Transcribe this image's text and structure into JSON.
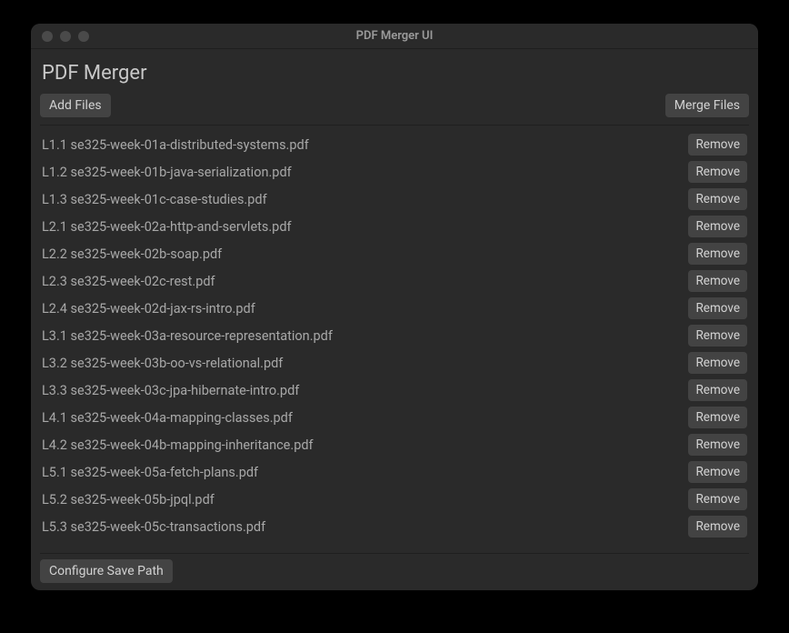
{
  "window": {
    "title": "PDF Merger UI"
  },
  "heading": "PDF Merger",
  "toolbar": {
    "add_files_label": "Add Files",
    "merge_files_label": "Merge Files"
  },
  "files": [
    {
      "name": "L1.1 se325-week-01a-distributed-systems.pdf"
    },
    {
      "name": "L1.2 se325-week-01b-java-serialization.pdf"
    },
    {
      "name": "L1.3 se325-week-01c-case-studies.pdf"
    },
    {
      "name": "L2.1 se325-week-02a-http-and-servlets.pdf"
    },
    {
      "name": "L2.2 se325-week-02b-soap.pdf"
    },
    {
      "name": "L2.3 se325-week-02c-rest.pdf"
    },
    {
      "name": "L2.4 se325-week-02d-jax-rs-intro.pdf"
    },
    {
      "name": "L3.1 se325-week-03a-resource-representation.pdf"
    },
    {
      "name": "L3.2 se325-week-03b-oo-vs-relational.pdf"
    },
    {
      "name": "L3.3 se325-week-03c-jpa-hibernate-intro.pdf"
    },
    {
      "name": "L4.1 se325-week-04a-mapping-classes.pdf"
    },
    {
      "name": "L4.2 se325-week-04b-mapping-inheritance.pdf"
    },
    {
      "name": "L5.1 se325-week-05a-fetch-plans.pdf"
    },
    {
      "name": "L5.2 se325-week-05b-jpql.pdf"
    },
    {
      "name": "L5.3 se325-week-05c-transactions.pdf"
    }
  ],
  "remove_label": "Remove",
  "footer": {
    "configure_save_path_label": "Configure Save Path"
  }
}
